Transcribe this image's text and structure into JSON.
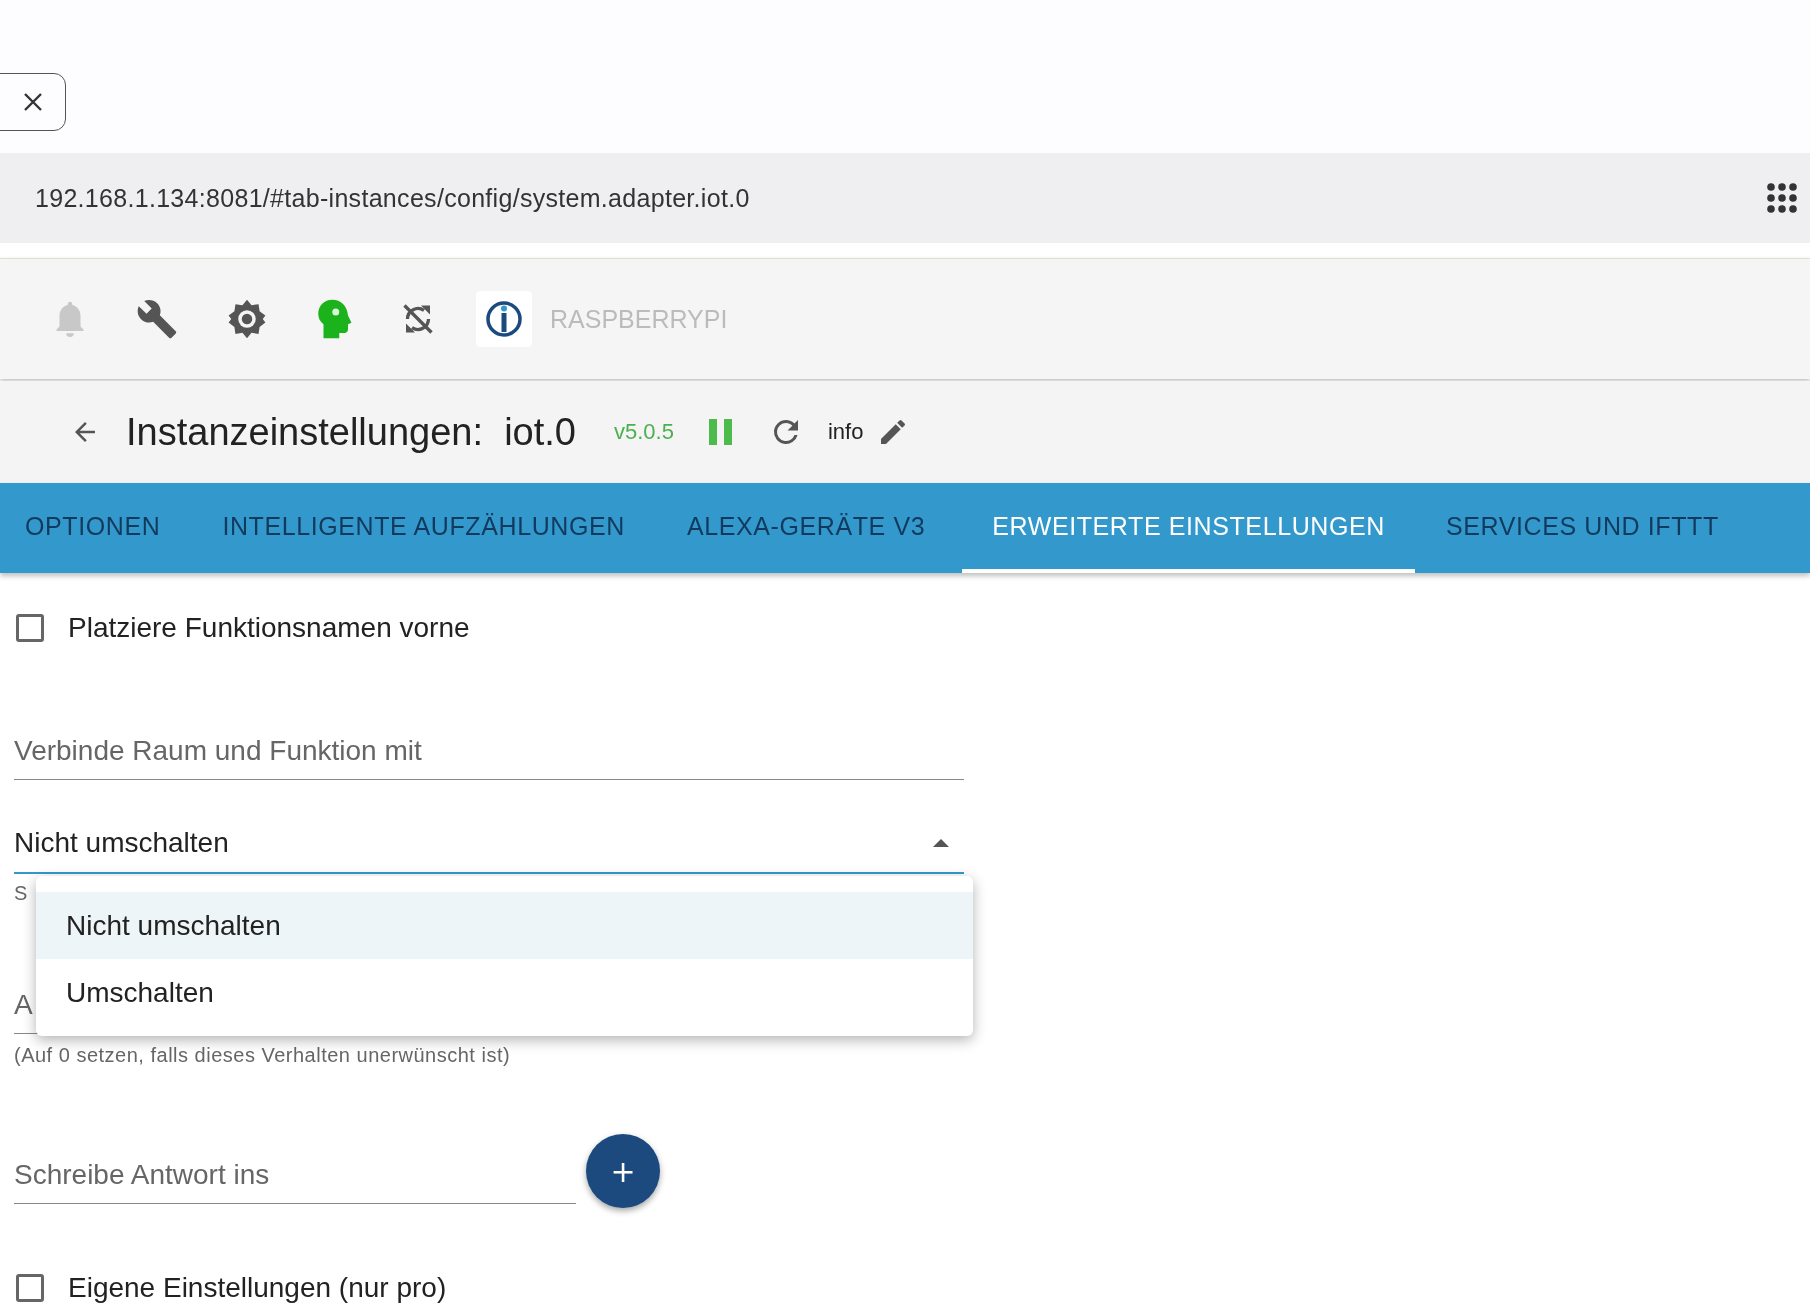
{
  "url_bar": {
    "url": "192.168.1.134:8081/#tab-instances/config/system.adapter.iot.0"
  },
  "toolbar": {
    "host": "RASPBERRYPI"
  },
  "header": {
    "title": "Instanzeinstellungen:  iot.0",
    "version": "v5.0.5",
    "info": "info"
  },
  "tabs": [
    {
      "label": "OPTIONEN",
      "selected": false
    },
    {
      "label": "INTELLIGENTE AUFZÄHLUNGEN",
      "selected": false
    },
    {
      "label": "ALEXA-GERÄTE V3",
      "selected": false
    },
    {
      "label": "ERWEITERTE EINSTELLUNGEN",
      "selected": true
    },
    {
      "label": "SERVICES UND IFTTT",
      "selected": false
    }
  ],
  "form": [
    {
      "kind": "checkbox",
      "label": "Platziere Funktionsnamen vorne",
      "checked": false
    },
    {
      "kind": "text",
      "label": "Verbinde Raum und Funktion mit"
    },
    {
      "kind": "select",
      "value": "Nicht umschalten",
      "helper": "S",
      "expanded": true,
      "options": [
        {
          "label": "Nicht umschalten",
          "selected": true
        },
        {
          "label": "Umschalten",
          "selected": false
        }
      ]
    },
    {
      "kind": "text",
      "label": "A",
      "helper": "(Auf 0 setzen, falls dieses Verhalten unerwünscht ist)"
    },
    {
      "kind": "text_add",
      "label": "Schreibe Antwort ins",
      "button": "+"
    },
    {
      "kind": "checkbox",
      "label": "Eigene Einstellungen (nur pro)",
      "checked": false
    }
  ]
}
